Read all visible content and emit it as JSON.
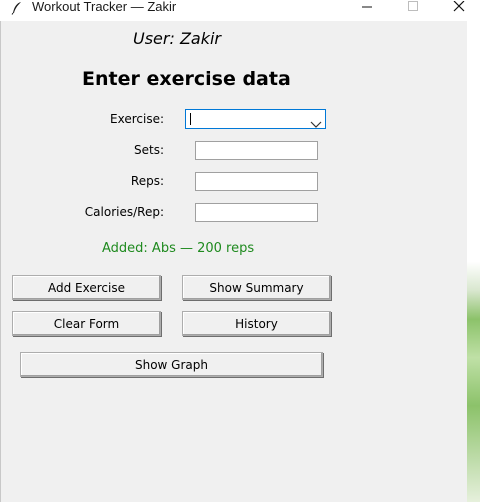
{
  "window": {
    "title": "Workout Tracker — Zakir",
    "icon": "feather-icon"
  },
  "user": {
    "label": "User: Zakir"
  },
  "form": {
    "heading": "Enter exercise data",
    "exercise_label": "Exercise:",
    "exercise_value": "",
    "sets_label": "Sets:",
    "sets_value": "",
    "reps_label": "Reps:",
    "reps_value": "",
    "calories_label": "Calories/Rep:",
    "calories_value": ""
  },
  "status": {
    "text": "Added: Abs — 200 reps",
    "color": "#1e8a1e"
  },
  "buttons": {
    "add_exercise": "Add Exercise",
    "show_summary": "Show Summary",
    "clear_form": "Clear Form",
    "history": "History",
    "show_graph": "Show Graph"
  }
}
